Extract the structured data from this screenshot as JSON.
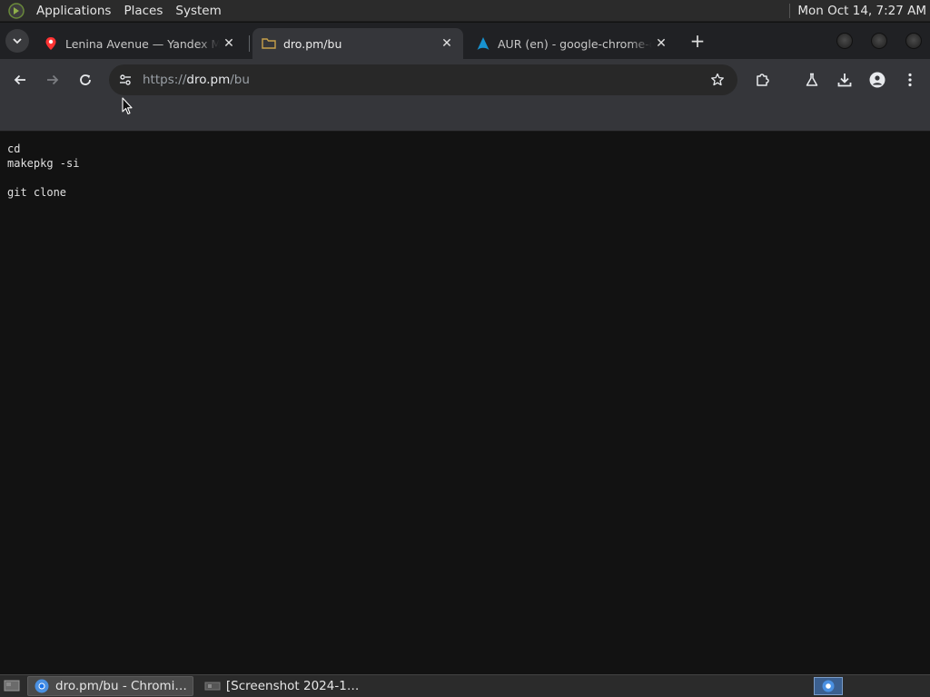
{
  "panel": {
    "menus": [
      "Applications",
      "Places",
      "System"
    ],
    "clock": "Mon Oct 14,  7:27 AM"
  },
  "browser": {
    "tabs": [
      {
        "title": "Lenina Avenue — Yandex Ma",
        "favicon": "map-pin-icon",
        "active": false
      },
      {
        "title": "dro.pm/bu",
        "favicon": "folder-icon",
        "active": true
      },
      {
        "title": "AUR (en) - google-chrome-d",
        "favicon": "arch-linux-icon",
        "active": false
      }
    ],
    "url_scheme": "https://",
    "url_host": "dro.pm",
    "url_path": "/bu",
    "accent_color": "#35363a"
  },
  "page": {
    "lines": [
      "cd",
      "makepkg -si",
      "",
      "git clone"
    ]
  },
  "taskbar": {
    "tasks": [
      {
        "label": "dro.pm/bu - Chromi…",
        "icon": "chromium-icon",
        "active": true
      },
      {
        "label": "[Screenshot 2024-1…",
        "icon": "screenshot-icon",
        "active": false
      }
    ]
  }
}
